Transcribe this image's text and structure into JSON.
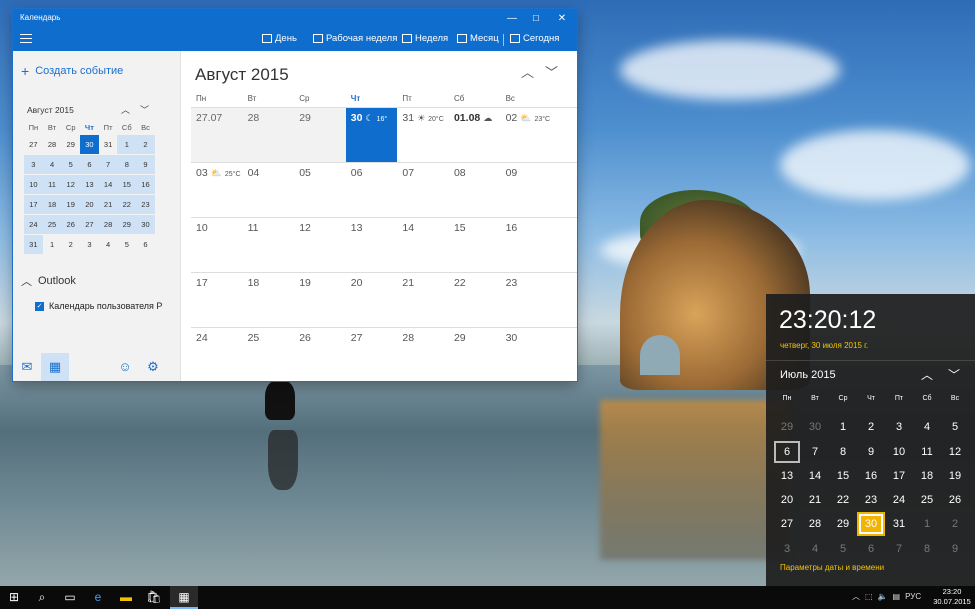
{
  "window": {
    "title": "Календарь",
    "min": "—",
    "max": "☐",
    "close": "✕"
  },
  "toolbar": {
    "day": "День",
    "workweek": "Рабочая неделя",
    "week": "Неделя",
    "month": "Месяц",
    "today": "Сегодня"
  },
  "sidebar": {
    "create_event": "Создать событие",
    "mini_calendar": {
      "title": "Август 2015",
      "days_of_week": [
        "Пн",
        "Вт",
        "Ср",
        "Чт",
        "Пт",
        "Сб",
        "Вс"
      ],
      "weeks": [
        [
          "27",
          "28",
          "29",
          "30",
          "31",
          "1",
          "2"
        ],
        [
          "3",
          "4",
          "5",
          "6",
          "7",
          "8",
          "9"
        ],
        [
          "10",
          "11",
          "12",
          "13",
          "14",
          "15",
          "16"
        ],
        [
          "17",
          "18",
          "19",
          "20",
          "21",
          "22",
          "23"
        ],
        [
          "24",
          "25",
          "26",
          "27",
          "28",
          "29",
          "30"
        ],
        [
          "31",
          "1",
          "2",
          "3",
          "4",
          "5",
          "6"
        ]
      ]
    },
    "account_section": "Outlook",
    "calendar_name": "Календарь пользователя Р"
  },
  "month_view": {
    "title": "Август 2015",
    "days_of_week": [
      "Пн",
      "Вт",
      "Ср",
      "Чт",
      "Пт",
      "Сб",
      "Вс"
    ],
    "weeks": [
      [
        {
          "d": "27.07"
        },
        {
          "d": "28"
        },
        {
          "d": "29"
        },
        {
          "d": "30",
          "wx": "16°",
          "wi": "☾"
        },
        {
          "d": "31",
          "wx": "20°C",
          "wi": "☀"
        },
        {
          "d": "01.08",
          "wi": "☁"
        },
        {
          "d": "02",
          "wx": "23°C",
          "wi": "⛅"
        }
      ],
      [
        {
          "d": "03",
          "wx": "25°C",
          "wi": "⛅"
        },
        {
          "d": "04"
        },
        {
          "d": "05"
        },
        {
          "d": "06"
        },
        {
          "d": "07"
        },
        {
          "d": "08"
        },
        {
          "d": "09"
        }
      ],
      [
        {
          "d": "10"
        },
        {
          "d": "11"
        },
        {
          "d": "12"
        },
        {
          "d": "13"
        },
        {
          "d": "14"
        },
        {
          "d": "15"
        },
        {
          "d": "16"
        }
      ],
      [
        {
          "d": "17"
        },
        {
          "d": "18"
        },
        {
          "d": "19"
        },
        {
          "d": "20"
        },
        {
          "d": "21"
        },
        {
          "d": "22"
        },
        {
          "d": "23"
        }
      ],
      [
        {
          "d": "24"
        },
        {
          "d": "25"
        },
        {
          "d": "26"
        },
        {
          "d": "27"
        },
        {
          "d": "28"
        },
        {
          "d": "29"
        },
        {
          "d": "30"
        }
      ]
    ]
  },
  "flyout": {
    "time": "23:20:12",
    "date": "четверг, 30 июля 2015 г.",
    "month_title": "Июль 2015",
    "days_of_week": [
      "Пн",
      "Вт",
      "Ср",
      "Чт",
      "Пт",
      "Сб",
      "Вс"
    ],
    "weeks": [
      [
        "29",
        "30",
        "1",
        "2",
        "3",
        "4",
        "5"
      ],
      [
        "6",
        "7",
        "8",
        "9",
        "10",
        "11",
        "12"
      ],
      [
        "13",
        "14",
        "15",
        "16",
        "17",
        "18",
        "19"
      ],
      [
        "20",
        "21",
        "22",
        "23",
        "24",
        "25",
        "26"
      ],
      [
        "27",
        "28",
        "29",
        "30",
        "31",
        "1",
        "2"
      ],
      [
        "3",
        "4",
        "5",
        "6",
        "7",
        "8",
        "9"
      ]
    ],
    "settings_link": "Параметры даты и времени"
  },
  "taskbar": {
    "language": "РУС",
    "clock_time": "23:20",
    "clock_date": "30.07.2015"
  },
  "colors": {
    "accent": "#0f6dce",
    "highlight": "#f2b400"
  }
}
